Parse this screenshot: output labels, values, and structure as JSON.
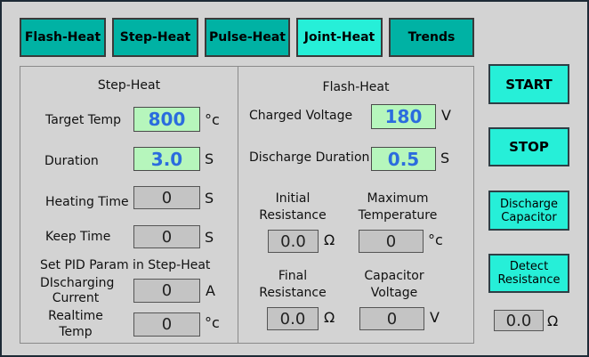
{
  "tabs": [
    {
      "label": "Flash-Heat"
    },
    {
      "label": "Step-Heat"
    },
    {
      "label": "Pulse-Heat"
    },
    {
      "label": "Joint-Heat"
    },
    {
      "label": "Trends"
    }
  ],
  "step_heat": {
    "title": "Step-Heat",
    "target_temp": {
      "label": "Target Temp",
      "value": "800",
      "unit": "°c"
    },
    "duration": {
      "label": "Duration",
      "value": "3.0",
      "unit": "S"
    },
    "heating_time": {
      "label": "Heating Time",
      "value": "0",
      "unit": "S"
    },
    "keep_time": {
      "label": "Keep Time",
      "value": "0",
      "unit": "S"
    },
    "pid_heading": "Set PID Param in Step-Heat",
    "discharging_current": {
      "label_1": "DIscharging",
      "label_2": "Current",
      "value": "0",
      "unit": "A"
    },
    "realtime_temp": {
      "label_1": "Realtime",
      "label_2": "Temp",
      "value": "0",
      "unit": "°c"
    }
  },
  "flash_heat": {
    "title": "Flash-Heat",
    "charged_voltage": {
      "label": "Charged Voltage",
      "value": "180",
      "unit": "V"
    },
    "discharge_duration": {
      "label": "Discharge Duration",
      "value": "0.5",
      "unit": "S"
    },
    "initial_resistance": {
      "label_1": "Initial",
      "label_2": "Resistance",
      "value": "0.0",
      "unit": "Ω"
    },
    "maximum_temperature": {
      "label_1": "Maximum",
      "label_2": "Temperature",
      "value": "0",
      "unit": "°c"
    },
    "final_resistance": {
      "label_1": "Final",
      "label_2": "Resistance",
      "value": "0.0",
      "unit": "Ω"
    },
    "capacitor_voltage": {
      "label_1": "Capacitor",
      "label_2": "Voltage",
      "value": "0",
      "unit": "V"
    }
  },
  "side": {
    "start_label": "START",
    "stop_label": "STOP",
    "discharge_label_1": "Discharge",
    "discharge_label_2": "Capacitor",
    "detect_label_1": "Detect",
    "detect_label_2": "Resistance",
    "resistance_value": "0.0",
    "resistance_unit": "Ω"
  },
  "colors": {
    "tab": "#00b2a4",
    "tab_active": "#26efd8",
    "button": "#26efd8",
    "input_green": "#b6f6bc",
    "value_blue": "#2b6cde",
    "readout_gray": "#c4c4c4",
    "background": "#d3d3d3"
  }
}
